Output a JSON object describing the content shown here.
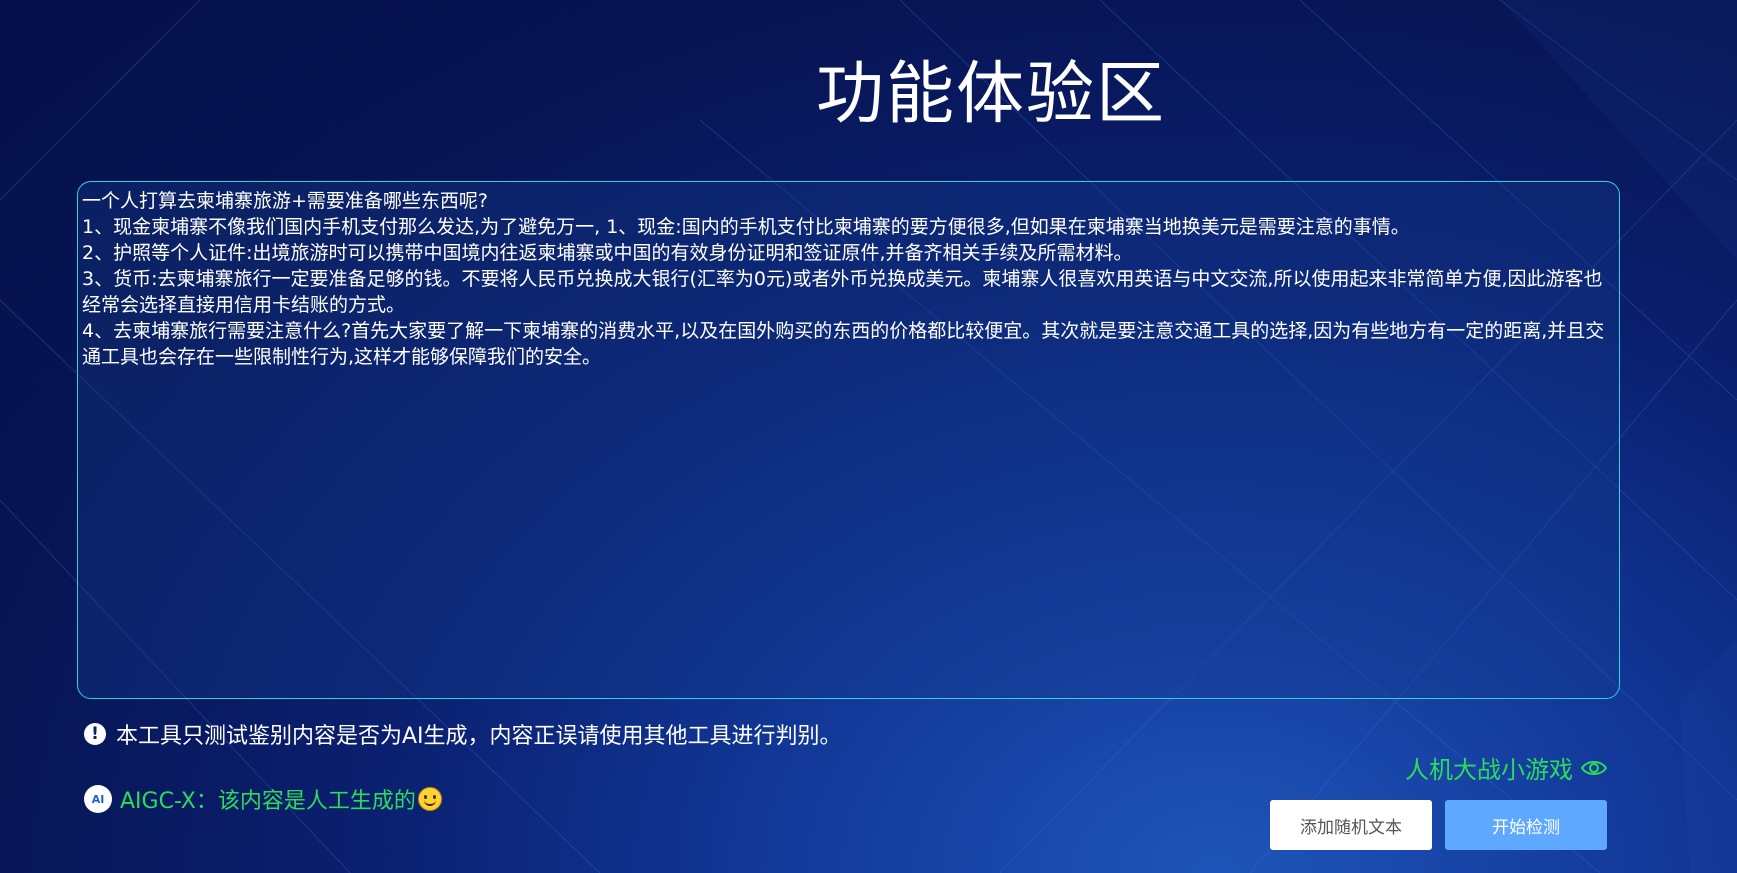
{
  "page": {
    "title": "功能体验区"
  },
  "input": {
    "lines": [
      "一个人打算去柬埔寨旅游+需要准备哪些东西呢?",
      "",
      "1、现金柬埔寨不像我们国内手机支付那么发达,为了避免万一, 1、现金:国内的手机支付比柬埔寨的要方便很多,但如果在柬埔寨当地换美元是需要注意的事情。",
      "2、护照等个人证件:出境旅游时可以携带中国境内往返柬埔寨或中国的有效身份证明和签证原件,并备齐相关手续及所需材料。",
      "3、货币:去柬埔寨旅行一定要准备足够的钱。不要将人民币兑换成大银行(汇率为0元)或者外币兑换成美元。柬埔寨人很喜欢用英语与中文交流,所以使用起来非常简单方便,因此游客也经常会选择直接用信用卡结账的方式。",
      "4、去柬埔寨旅行需要注意什么?首先大家要了解一下柬埔寨的消费水平,以及在国外购买的东西的价格都比较便宜。其次就是要注意交通工具的选择,因为有些地方有一定的距离,并且交通工具也会存在一些限制性行为,这样才能够保障我们的安全。"
    ]
  },
  "notice": {
    "icon": "exclamation-icon",
    "text": "本工具只测试鉴别内容是否为AI生成，内容正误请使用其他工具进行判别。"
  },
  "result": {
    "logo_text": "AI",
    "text": "AIGC-X：该内容是人工生成的",
    "emoji": "smile-icon",
    "color": "#2bdc5a"
  },
  "game_link": {
    "label": "人机大战小游戏",
    "icon": "eye-icon"
  },
  "buttons": {
    "random_label": "添加随机文本",
    "detect_label": "开始检测"
  },
  "colors": {
    "accent_green": "#2bdc5a",
    "primary_button": "#5ea9ff",
    "panel_border": "#2fd0e0"
  }
}
